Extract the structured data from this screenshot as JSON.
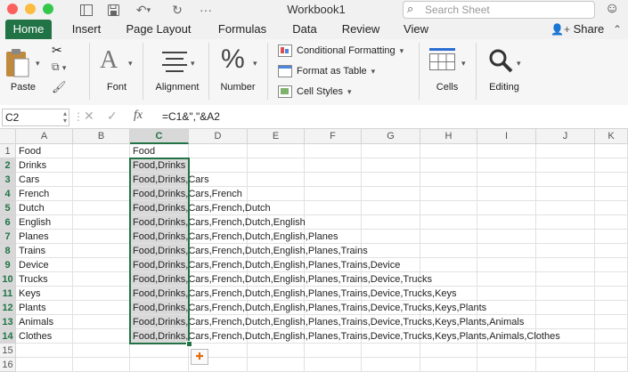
{
  "window": {
    "title": "Workbook1"
  },
  "search": {
    "placeholder": "Search Sheet"
  },
  "tabs": [
    "Home",
    "Insert",
    "Page Layout",
    "Formulas",
    "Data",
    "Review",
    "View"
  ],
  "share_label": "Share",
  "ribbon": {
    "paste": "Paste",
    "font": "Font",
    "alignment": "Alignment",
    "number": "Number",
    "conditional_formatting": "Conditional Formatting",
    "format_as_table": "Format as Table",
    "cell_styles": "Cell Styles",
    "cells": "Cells",
    "editing": "Editing"
  },
  "formula_bar": {
    "name_box": "C2",
    "fx": "fx",
    "formula": "=C1&\",\"&A2"
  },
  "columns": [
    "A",
    "B",
    "C",
    "D",
    "E",
    "F",
    "G",
    "H",
    "I",
    "J",
    "K"
  ],
  "rows": [
    "1",
    "2",
    "3",
    "4",
    "5",
    "6",
    "7",
    "8",
    "9",
    "10",
    "11",
    "12",
    "13",
    "14",
    "15",
    "16"
  ],
  "column_a": [
    "Food",
    "Drinks",
    "Cars",
    "French",
    "Dutch",
    "English",
    "Planes",
    "Trains",
    "Device",
    "Trucks",
    "Keys",
    "Plants",
    "Animals",
    "Clothes"
  ],
  "column_c": [
    "Food",
    "Food,Drinks",
    "Food,Drinks,Cars",
    "Food,Drinks,Cars,French",
    "Food,Drinks,Cars,French,Dutch",
    "Food,Drinks,Cars,French,Dutch,English",
    "Food,Drinks,Cars,French,Dutch,English,Planes",
    "Food,Drinks,Cars,French,Dutch,English,Planes,Trains",
    "Food,Drinks,Cars,French,Dutch,English,Planes,Trains,Device",
    "Food,Drinks,Cars,French,Dutch,English,Planes,Trains,Device,Trucks",
    "Food,Drinks,Cars,French,Dutch,English,Planes,Trains,Device,Trucks,Keys",
    "Food,Drinks,Cars,French,Dutch,English,Planes,Trains,Device,Trucks,Keys,Plants",
    "Food,Drinks,Cars,French,Dutch,English,Planes,Trains,Device,Trucks,Keys,Plants,Animals",
    "Food,Drinks,Cars,French,Dutch,English,Planes,Trains,Device,Trucks,Keys,Plants,Animals,Clothes"
  ],
  "colors": {
    "accent": "#217346",
    "close": "#fc605c",
    "minimize": "#fdbc40",
    "zoom": "#34c84a"
  },
  "icons": [
    "close-icon",
    "minimize-icon",
    "zoom-icon",
    "sidebar-icon",
    "save-icon",
    "undo-icon",
    "redo-icon",
    "search-icon",
    "smiley-icon",
    "person-add-icon",
    "chevron-up-icon",
    "paste-icon",
    "cut-icon",
    "copy-icon",
    "format-painter-icon",
    "font-icon",
    "alignment-icon",
    "percent-icon",
    "conditional-formatting-icon",
    "format-table-icon",
    "cell-styles-icon",
    "cells-icon",
    "magnifier-icon",
    "paste-options-icon"
  ]
}
